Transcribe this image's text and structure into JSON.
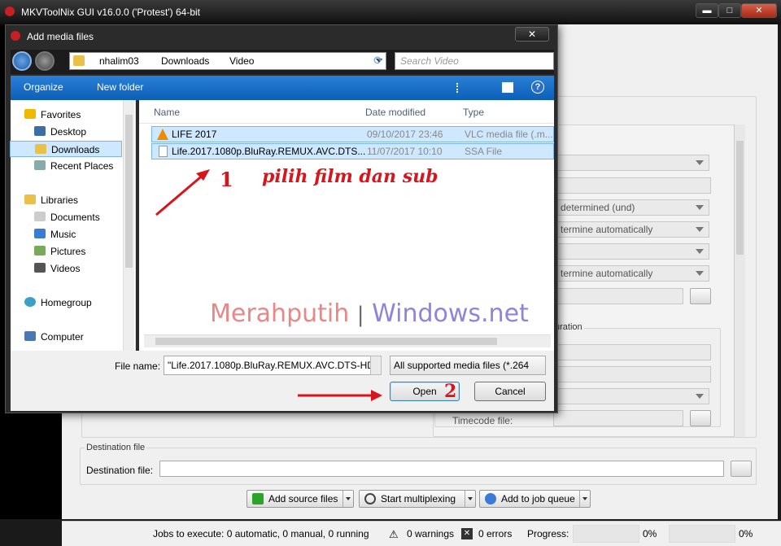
{
  "main_window": {
    "title": "MKVToolNix GUI v16.0.0 ('Protest') 64-bit",
    "controls": {
      "minimize": "▬",
      "maximize": "□",
      "close": "✕"
    },
    "combos": [
      "",
      "",
      "determined (und)",
      "termine automatically",
      "",
      "termine automatically"
    ],
    "group_duration_label": "uration",
    "timecode_label": "Timecode file:",
    "destination": {
      "group_label": "Destination file",
      "field_label": "Destination file:",
      "value": ""
    },
    "toolbar": {
      "add_source": "Add source files",
      "start_mux": "Start multiplexing",
      "add_queue": "Add to job queue"
    },
    "status": {
      "jobs": "Jobs to execute:  0 automatic, 0 manual, 0 running",
      "warnings": "0 warnings",
      "errors": "0 errors",
      "progress_label": "Progress:",
      "progress1": "0%",
      "progress2": "0%"
    }
  },
  "dialog": {
    "title": "Add media files",
    "close": "✕",
    "breadcrumb": [
      "nhalim03",
      "Downloads",
      "Video"
    ],
    "search_placeholder": "Search Video",
    "commands": {
      "organize": "Organize",
      "new_folder": "New folder"
    },
    "nav": [
      {
        "label": "Favorites",
        "group": true
      },
      {
        "label": "Desktop"
      },
      {
        "label": "Downloads",
        "selected": true
      },
      {
        "label": "Recent Places"
      },
      {
        "label": "Libraries",
        "group": true
      },
      {
        "label": "Documents"
      },
      {
        "label": "Music"
      },
      {
        "label": "Pictures"
      },
      {
        "label": "Videos"
      },
      {
        "label": "Homegroup",
        "group": true
      },
      {
        "label": "Computer",
        "group": true
      }
    ],
    "columns": {
      "name": "Name",
      "date": "Date modified",
      "type": "Type"
    },
    "files": [
      {
        "name": "LIFE 2017",
        "date": "09/10/2017 23:46",
        "type": "VLC media file (.m..."
      },
      {
        "name": "Life.2017.1080p.BluRay.REMUX.AVC.DTS...",
        "date": "11/07/2017 10:10",
        "type": "SSA File"
      }
    ],
    "filename_label": "File name:",
    "filename_value": "\"Life.2017.1080p.BluRay.REMUX.AVC.DTS-HD.",
    "filetype_value": "All supported media files (*.264",
    "open": "Open",
    "cancel": "Cancel"
  },
  "annotations": {
    "step1": "1",
    "step1_text": "pilih film dan sub",
    "step2": "2"
  },
  "watermark": {
    "part1": "Merahputih",
    "sep": "|",
    "part2": "Windows.net"
  }
}
